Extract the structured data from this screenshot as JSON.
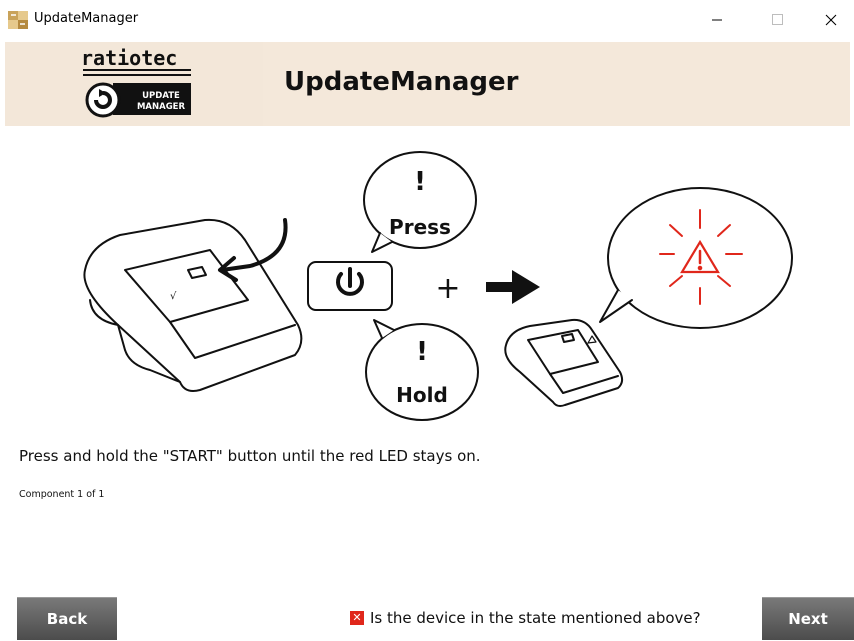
{
  "window": {
    "title": "UpdateManager",
    "icon": "app-icon",
    "controls": [
      "minimize-icon",
      "maximize-icon",
      "close-icon"
    ]
  },
  "header": {
    "title": "UpdateManager",
    "logo": {
      "brand": "ratiotec",
      "line1": "UPDATE",
      "line2": "MANAGER"
    }
  },
  "illustration": {
    "bubble_top": "Press",
    "bubble_bottom": "Hold",
    "exclamation": "!",
    "plus": "+"
  },
  "instruction": "Press and hold the \"START\" button until the red LED stays on.",
  "component_status": "Component 1 of 1",
  "footer": {
    "back_label": "Back",
    "next_label": "Next",
    "question": "Is the device in the state mentioned above?",
    "checkbox_state": "unchecked",
    "checkbox_mark": "✕"
  },
  "colors": {
    "header_bg": "#f4e8da",
    "button_bg": "#5d5d5d",
    "alert_red": "#e0271b"
  }
}
